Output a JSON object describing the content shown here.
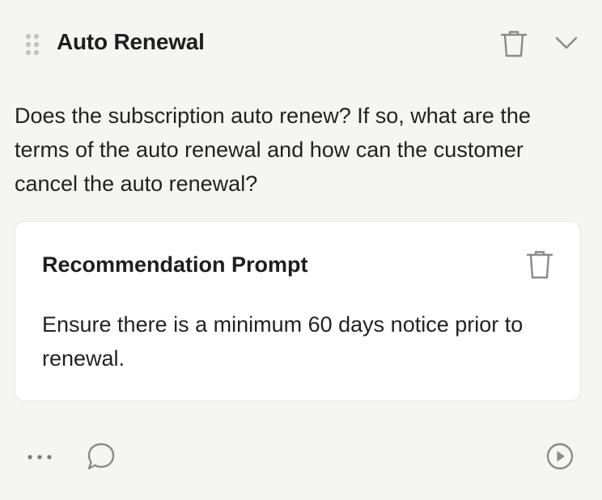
{
  "card": {
    "title": "Auto Renewal",
    "question": "Does the subscription auto renew? If so, what are the terms of the auto renewal and how can the customer cancel the auto renewal?",
    "icons": {
      "drag": "drag-handle-icon",
      "delete": "trash-icon",
      "collapse": "chevron-down-icon"
    }
  },
  "recommendation": {
    "title": "Recommendation Prompt",
    "body": "Ensure there is a minimum 60 days notice prior to renewal.",
    "icons": {
      "delete": "trash-icon"
    }
  },
  "footer": {
    "icons": [
      "more-icon",
      "comment-icon",
      "play-icon"
    ]
  },
  "colors": {
    "background": "#f5f5f4",
    "card": "#ffffff",
    "icon": "#8a8a8a",
    "text": "#1e1e1e"
  }
}
